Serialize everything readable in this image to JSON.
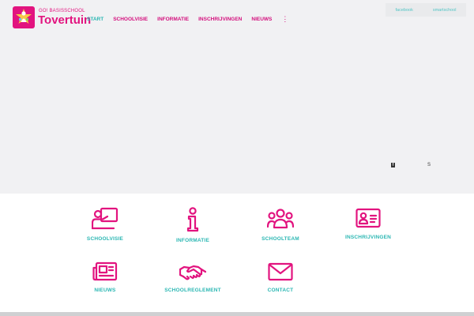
{
  "brand": {
    "subtitle": "GO! BASISSCHOOL",
    "name": "Tovertuin",
    "color": "#e2147f"
  },
  "nav": {
    "items": [
      {
        "label": "START",
        "active": true
      },
      {
        "label": "SCHOOLVISIE",
        "active": false
      },
      {
        "label": "INFORMATIE",
        "active": false
      },
      {
        "label": "INSCHRIJVINGEN",
        "active": false
      },
      {
        "label": "NIEUWS",
        "active": false
      }
    ],
    "more": "⋮"
  },
  "social": {
    "facebook": "facebook",
    "smartschool": "smartschool"
  },
  "hero_icons": {
    "facebook_icon": "f",
    "smartschool_icon": "S"
  },
  "tiles": [
    {
      "label": "SCHOOLVISIE",
      "icon": "presentation-icon"
    },
    {
      "label": "INFORMATIE",
      "icon": "info-icon"
    },
    {
      "label": "SCHOOLTEAM",
      "icon": "team-icon"
    },
    {
      "label": "INSCHRIJVINGEN",
      "icon": "id-card-icon"
    },
    {
      "label": "NIEUWS",
      "icon": "newspaper-icon"
    },
    {
      "label": "SCHOOLREGLEMENT",
      "icon": "handshake-icon"
    },
    {
      "label": "CONTACT",
      "icon": "mail-icon"
    }
  ],
  "colors": {
    "accent_pink": "#e2147f",
    "accent_teal": "#2bb7b3",
    "hero_bg": "#f1f1f3"
  }
}
